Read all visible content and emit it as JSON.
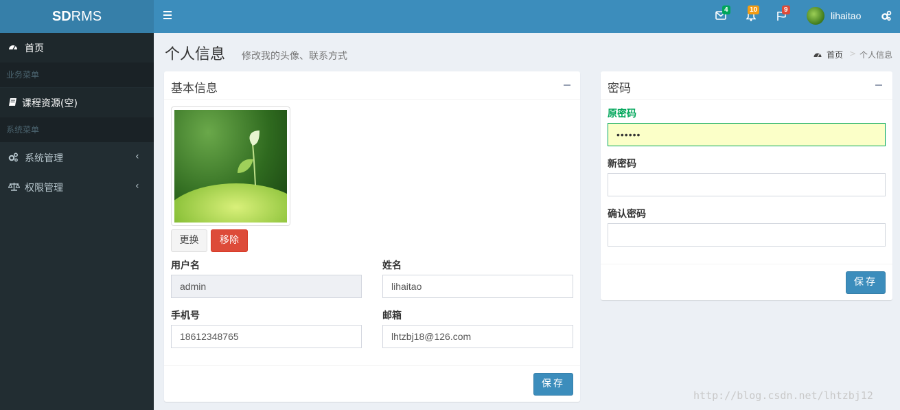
{
  "app": {
    "logo_bold": "SD",
    "logo_rest": "RMS"
  },
  "header": {
    "notifications": [
      {
        "icon": "envelope-icon",
        "count": "4",
        "color": "#00a65a"
      },
      {
        "icon": "bell-icon",
        "count": "10",
        "color": "#f39c12"
      },
      {
        "icon": "flag-icon",
        "count": "9",
        "color": "#dd4b39"
      }
    ],
    "username": "lihaitao"
  },
  "sidebar": {
    "items": [
      {
        "label": "首页",
        "icon": "dashboard-icon"
      },
      {
        "header": "业务菜单"
      },
      {
        "label": "课程资源(空)",
        "icon": "book-icon"
      },
      {
        "header": "系统菜单"
      },
      {
        "label": "系统管理",
        "icon": "cogs-icon",
        "chevron": "‹"
      },
      {
        "label": "权限管理",
        "icon": "balance-scale-icon",
        "chevron": "‹"
      }
    ]
  },
  "page": {
    "title": "个人信息",
    "subtitle": "修改我的头像、联系方式",
    "breadcrumb": {
      "home": "首页",
      "separator": ">",
      "current": "个人信息"
    }
  },
  "basic_info": {
    "title": "基本信息",
    "change_button": "更换",
    "remove_button": "移除",
    "fields": {
      "username": {
        "label": "用户名",
        "value": "admin"
      },
      "name": {
        "label": "姓名",
        "value": "lihaitao"
      },
      "phone": {
        "label": "手机号",
        "value": "18612348765"
      },
      "email": {
        "label": "邮箱",
        "value": "lhtzbj18@126.com"
      }
    },
    "save_button": "保存"
  },
  "password": {
    "title": "密码",
    "fields": {
      "old": {
        "label": "原密码",
        "value": "••••••"
      },
      "new": {
        "label": "新密码",
        "value": ""
      },
      "confirm": {
        "label": "确认密码",
        "value": ""
      }
    },
    "save_button": "保存"
  },
  "watermark": "http://blog.csdn.net/lhtzbj12"
}
